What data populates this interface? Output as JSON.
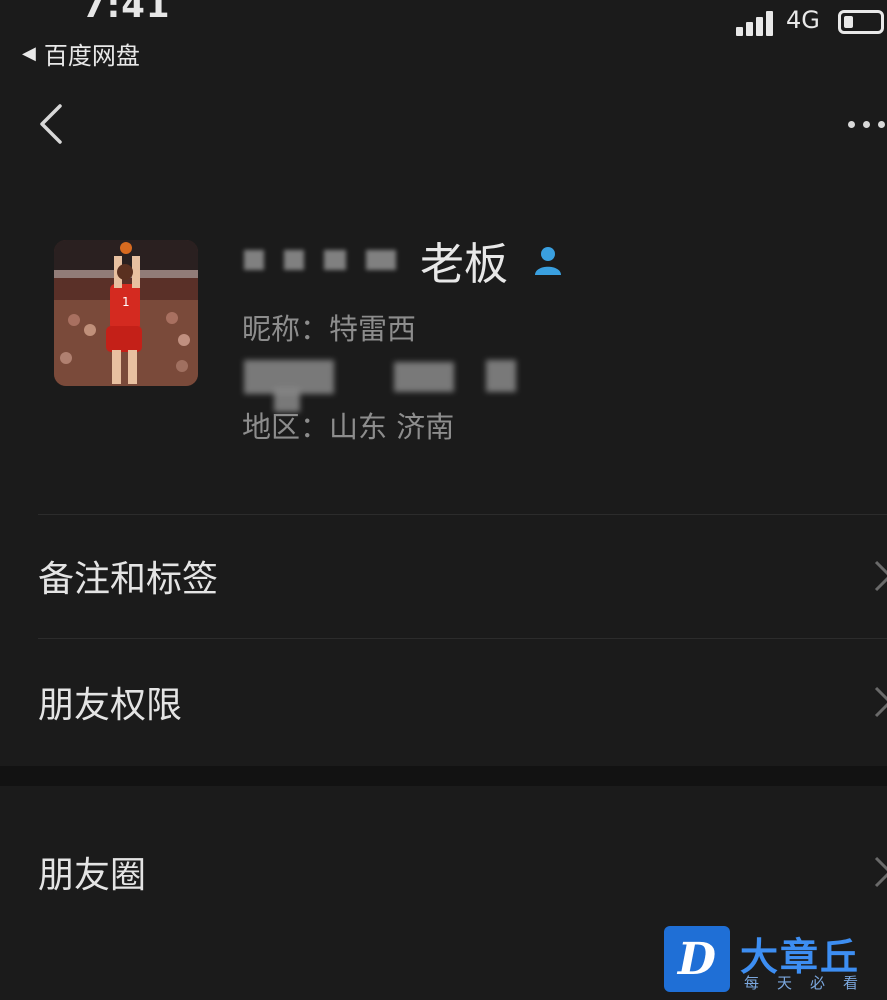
{
  "status_bar": {
    "time": "7:41",
    "back_app": "百度网盘",
    "network": "4G",
    "battery_level": 0.25
  },
  "profile": {
    "display_name": "老板",
    "nickname": "昵称：特雷西",
    "region": "地区：山东 济南"
  },
  "menu": {
    "remark_tags": "备注和标签",
    "friend_permissions": "朋友权限",
    "moments": "朋友圈"
  },
  "watermark": {
    "title": "大章丘",
    "subtitle": "每天必看"
  }
}
